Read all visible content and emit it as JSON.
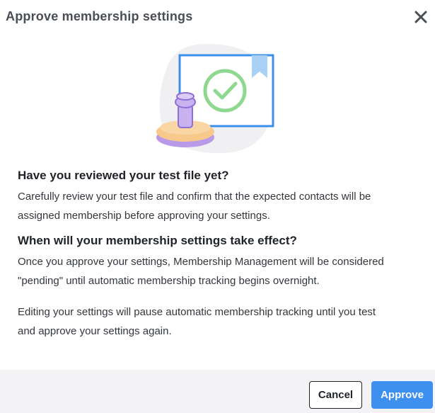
{
  "dialog": {
    "title": "Approve membership settings",
    "close_icon": "close-icon"
  },
  "illustration": {
    "icon": "approval-stamp-illustration",
    "colors": {
      "background_blob": "#f0f0f2",
      "frame": "#3b8fe8",
      "check": "#8fd88f",
      "stamp_purple": "#b89ae8",
      "stamp_orange": "#f7c98a"
    }
  },
  "sections": {
    "review": {
      "heading": "Have you reviewed your test file yet?",
      "line1": "Carefully review your test file and confirm that the expected contacts will be",
      "line2": "assigned membership before approving your settings."
    },
    "effect": {
      "heading": "When will your membership settings take effect?",
      "line1": "Once you approve your settings, Membership Management will be considered",
      "line2": "\"pending\" until automatic membership tracking begins overnight."
    },
    "editing": {
      "line1": "Editing your settings will pause automatic membership tracking until you test",
      "line2": "and approve your settings again."
    }
  },
  "footer": {
    "cancel_label": "Cancel",
    "approve_label": "Approve",
    "approve_color": "#3d8ff0"
  }
}
